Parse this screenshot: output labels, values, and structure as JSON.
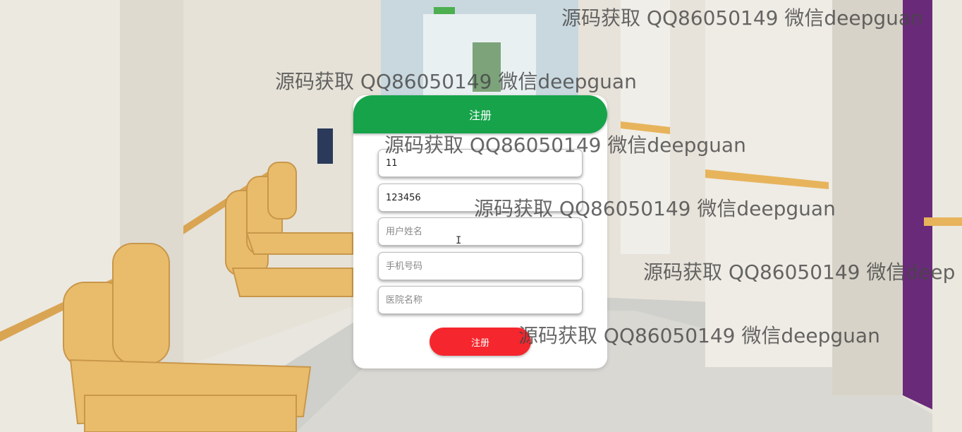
{
  "header": {
    "title": "注册"
  },
  "form": {
    "username_value": "11",
    "password_value": "123456",
    "name_placeholder": "用户姓名",
    "phone_placeholder": "手机号码",
    "hospital_placeholder": "医院名称",
    "submit_label": "注册"
  },
  "watermarks": [
    "源码获取 QQ86050149 微信deepguan",
    "源码获取 QQ86050149 微信deepguan",
    "源码获取 QQ86050149 微信deepguan",
    "源码获取 QQ86050149 微信deepguan",
    "源码获取 QQ86050149 微信deep",
    "源码获取 QQ86050149 微信deepguan"
  ],
  "colors": {
    "header_bg": "#16a34a",
    "submit_bg": "#f5262d",
    "card_bg": "#ffffff"
  },
  "icons": {
    "cursor": "text-cursor-icon"
  }
}
